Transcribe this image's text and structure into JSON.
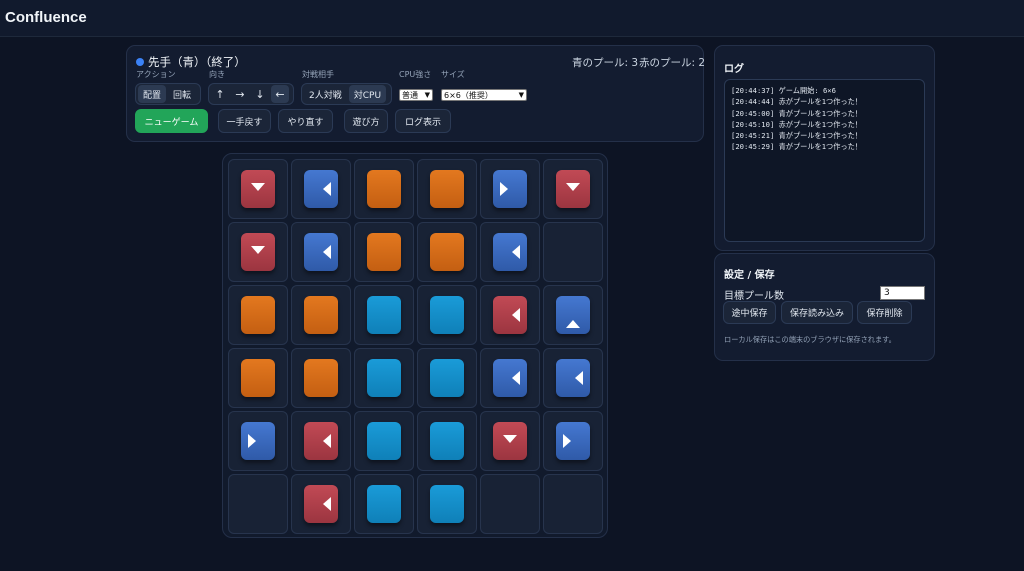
{
  "app": {
    "title": "Confluence"
  },
  "status": {
    "turn_text": "先手（青）（終了）",
    "blue_pools": "青のプール: 3",
    "red_pools": "赤のプール: 2",
    "turn_color": "#3b82f6"
  },
  "controls": {
    "action_label": "アクション",
    "action_options": [
      "配置",
      "回転"
    ],
    "action_selected": "配置",
    "direction_label": "向き",
    "direction_options": [
      "↑",
      "→",
      "↓",
      "←"
    ],
    "direction_selected": "←",
    "opponent_label": "対戦相手",
    "opponent_options": [
      "2人対戦",
      "対CPU"
    ],
    "opponent_selected": "対CPU",
    "cpu_label": "CPU強さ",
    "cpu_value": "普通",
    "size_label": "サイズ",
    "size_value": "6×6（推奨）"
  },
  "actions": {
    "new_game": "ニューゲーム",
    "undo": "一手戻す",
    "redo": "やり直す",
    "how_to": "遊び方",
    "show_log": "ログ表示"
  },
  "log": {
    "title": "ログ",
    "entries": [
      "[20:44:37] ゲーム開始: 6×6",
      "[20:44:44] 赤がプールを1つ作った！",
      "[20:45:00] 青がプールを1つ作った！",
      "[20:45:10] 赤がプールを1つ作った！",
      "[20:45:21] 青がプールを1つ作った！",
      "[20:45:29] 青がプールを1つ作った！"
    ]
  },
  "settings": {
    "title": "設定 / 保存",
    "target_label": "目標プール数",
    "target_value": "3",
    "save": "途中保存",
    "load": "保存読み込み",
    "delete": "保存削除",
    "note": "ローカル保存はこの端末のブラウザに保存されます。"
  },
  "board": {
    "rows": 6,
    "cols": 6,
    "cells": [
      [
        {
          "c": "red",
          "d": "down"
        },
        {
          "c": "blue",
          "d": "left"
        },
        {
          "c": "orange"
        },
        {
          "c": "orange"
        },
        {
          "c": "blue",
          "d": "right"
        },
        {
          "c": "red",
          "d": "down"
        }
      ],
      [
        {
          "c": "red",
          "d": "down"
        },
        {
          "c": "blue",
          "d": "left"
        },
        {
          "c": "orange"
        },
        {
          "c": "orange"
        },
        {
          "c": "blue",
          "d": "left"
        },
        null
      ],
      [
        {
          "c": "orange"
        },
        {
          "c": "orange"
        },
        {
          "c": "cyan"
        },
        {
          "c": "cyan"
        },
        {
          "c": "red",
          "d": "left"
        },
        {
          "c": "blue",
          "d": "up"
        }
      ],
      [
        {
          "c": "orange"
        },
        {
          "c": "orange"
        },
        {
          "c": "cyan"
        },
        {
          "c": "cyan"
        },
        {
          "c": "blue",
          "d": "left"
        },
        {
          "c": "blue",
          "d": "left"
        }
      ],
      [
        {
          "c": "blue",
          "d": "right"
        },
        {
          "c": "red",
          "d": "left"
        },
        {
          "c": "cyan"
        },
        {
          "c": "cyan"
        },
        {
          "c": "red",
          "d": "down"
        },
        {
          "c": "blue",
          "d": "right"
        }
      ],
      [
        null,
        {
          "c": "red",
          "d": "left"
        },
        {
          "c": "cyan"
        },
        {
          "c": "cyan"
        },
        null,
        null
      ]
    ]
  }
}
